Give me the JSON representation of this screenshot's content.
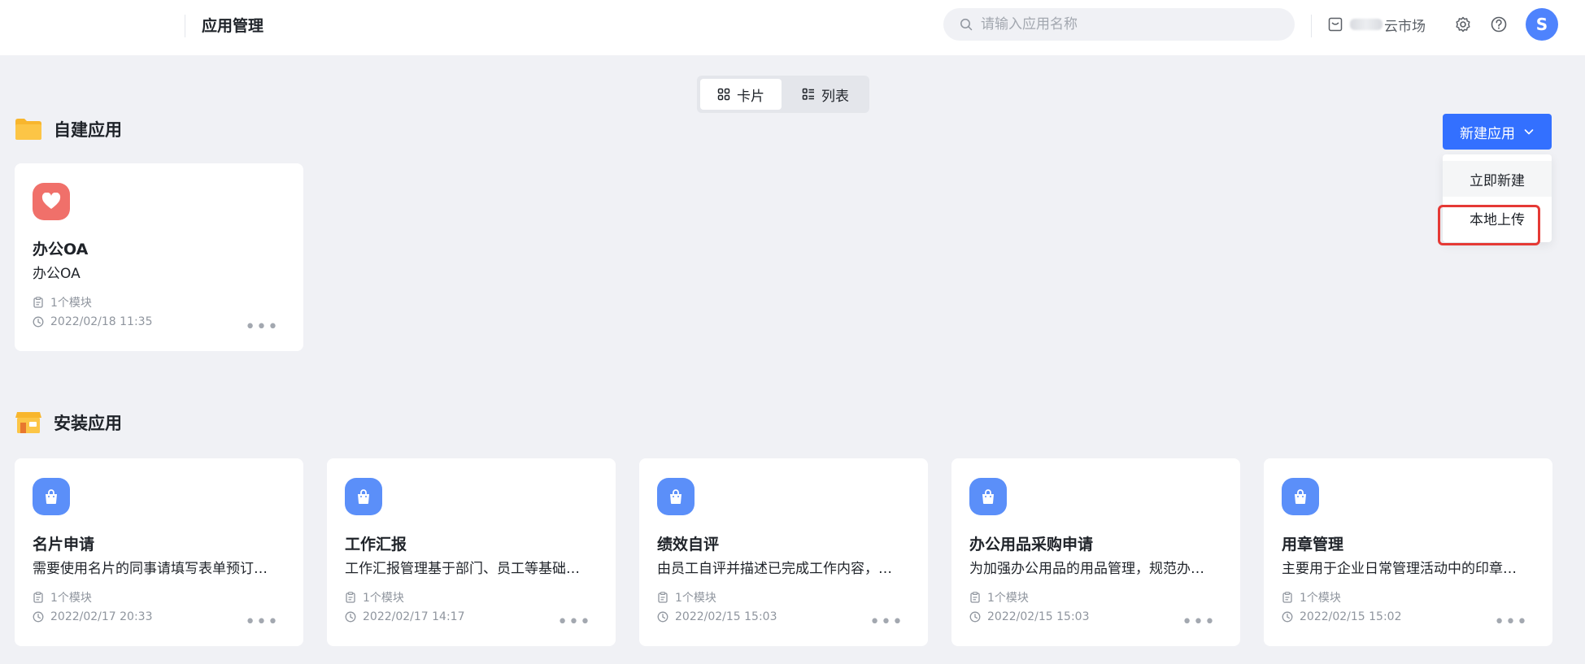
{
  "header": {
    "title": "应用管理",
    "search_placeholder": "请输入应用名称",
    "market_label": "云市场",
    "avatar_letter": "S"
  },
  "view_toggle": {
    "card_label": "卡片",
    "list_label": "列表",
    "active": "card"
  },
  "self_built": {
    "title": "自建应用",
    "new_button_label": "新建应用",
    "menu": [
      "立即新建",
      "本地上传"
    ],
    "apps": [
      {
        "name": "办公OA",
        "desc": "办公OA",
        "modules": "1个模块",
        "time": "2022/02/18 11:35",
        "icon": "heart-icon",
        "color": "#f0706a"
      }
    ]
  },
  "installed": {
    "title": "安装应用",
    "apps": [
      {
        "name": "名片申请",
        "desc": "需要使用名片的同事请填写表单预订…",
        "modules": "1个模块",
        "time": "2022/02/17 20:33",
        "icon": "bag-icon",
        "color": "#5b8ff9"
      },
      {
        "name": "工作汇报",
        "desc": "工作汇报管理基于部门、员工等基础…",
        "modules": "1个模块",
        "time": "2022/02/17 14:17",
        "icon": "bag-icon",
        "color": "#5b8ff9"
      },
      {
        "name": "绩效自评",
        "desc": "由员工自评并描述已完成工作内容，…",
        "modules": "1个模块",
        "time": "2022/02/15 15:03",
        "icon": "bag-icon",
        "color": "#5b8ff9"
      },
      {
        "name": "办公用品采购申请",
        "desc": "为加强办公用品的用品管理，规范办…",
        "modules": "1个模块",
        "time": "2022/02/15 15:03",
        "icon": "bag-icon",
        "color": "#5b8ff9"
      },
      {
        "name": "用章管理",
        "desc": "主要用于企业日常管理活动中的印章…",
        "modules": "1个模块",
        "time": "2022/02/15 15:02",
        "icon": "bag-icon",
        "color": "#5b8ff9"
      }
    ]
  },
  "colors": {
    "accent": "#3370ff",
    "background": "#f0f1f5",
    "highlight_border": "#e53935"
  }
}
